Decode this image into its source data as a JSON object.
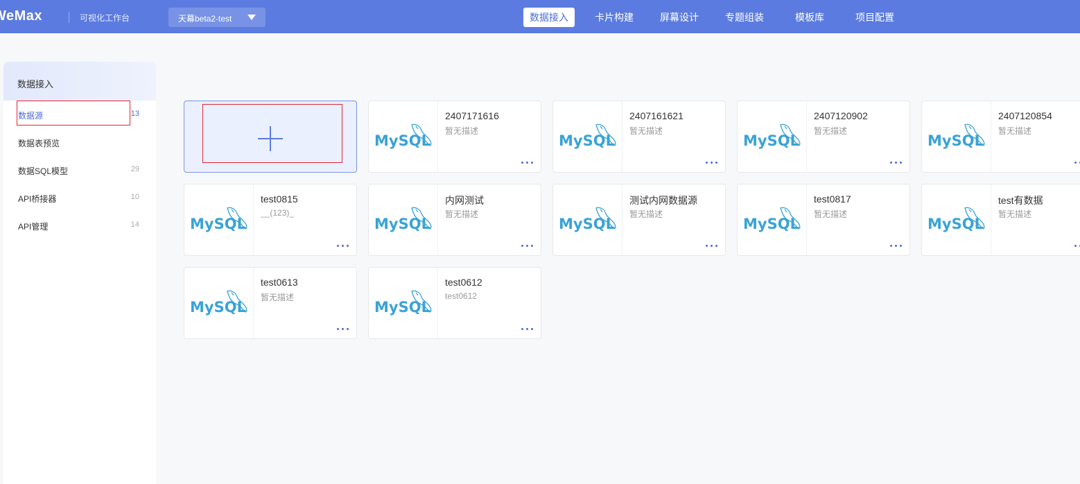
{
  "header": {
    "logo": "WeMax",
    "subtitle": "可视化工作台",
    "project": "天幕beta2-test",
    "nav": [
      "数据接入",
      "卡片构建",
      "屏幕设计",
      "专题组装",
      "模板库",
      "项目配置"
    ]
  },
  "sidebar": {
    "title": "数据接入",
    "items": [
      {
        "label": "数据源",
        "count": "13"
      },
      {
        "label": "数据表预览",
        "count": ""
      },
      {
        "label": "数据SQL模型",
        "count": "29"
      },
      {
        "label": "API桥接器",
        "count": "10"
      },
      {
        "label": "API管理",
        "count": "14"
      }
    ]
  },
  "cards": [
    {
      "name": "2407171616",
      "desc": "暂无描述",
      "type": "MySQL"
    },
    {
      "name": "2407161621",
      "desc": "暂无描述",
      "type": "MySQL"
    },
    {
      "name": "2407120902",
      "desc": "暂无描述",
      "type": "MySQL"
    },
    {
      "name": "2407120854",
      "desc": "暂无描述",
      "type": "MySQL"
    },
    {
      "name": "test0815",
      "desc": "__(123)_",
      "type": "MySQL"
    },
    {
      "name": "内网测试",
      "desc": "暂无描述",
      "type": "MySQL"
    },
    {
      "name": "测试内网数据源",
      "desc": "暂无描述",
      "type": "MySQL"
    },
    {
      "name": "test0817",
      "desc": "暂无描述",
      "type": "MySQL"
    },
    {
      "name": "test有数据",
      "desc": "暂无描述",
      "type": "MySQL"
    },
    {
      "name": "test0613",
      "desc": "暂无描述",
      "type": "MySQL"
    },
    {
      "name": "test0612",
      "desc": "test0612",
      "type": "MySQL"
    }
  ],
  "colors": {
    "brand": "#5b7be0",
    "mysql": "#3aa3d6",
    "highlight": "#e3262d"
  }
}
